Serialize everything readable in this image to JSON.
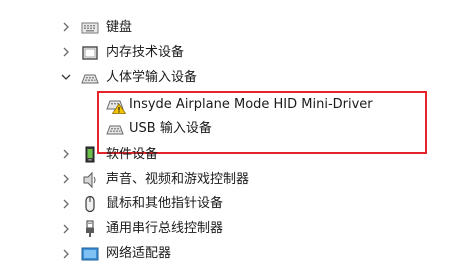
{
  "tree": {
    "items": [
      {
        "label": "键盘",
        "expanded": false,
        "icon": "keyboard-icon"
      },
      {
        "label": "内存技术设备",
        "expanded": false,
        "icon": "memory-device-icon"
      },
      {
        "label": "人体学输入设备",
        "expanded": true,
        "icon": "hid-icon",
        "children": [
          {
            "label": "Insyde Airplane Mode HID Mini-Driver",
            "icon": "hid-warning-icon",
            "warning": true
          },
          {
            "label": "USB 输入设备",
            "icon": "hid-icon"
          }
        ]
      },
      {
        "label": "软件设备",
        "expanded": false,
        "icon": "software-device-icon"
      },
      {
        "label": "声音、视频和游戏控制器",
        "expanded": false,
        "icon": "speaker-icon"
      },
      {
        "label": "鼠标和其他指针设备",
        "expanded": false,
        "icon": "mouse-icon"
      },
      {
        "label": "通用串行总线控制器",
        "expanded": false,
        "icon": "usb-icon"
      },
      {
        "label": "网络适配器",
        "expanded": false,
        "icon": "network-adapter-icon"
      }
    ]
  },
  "colors": {
    "highlight_border": "#e3242b",
    "warning": "#f5c400",
    "chevron": "#6b6b6b"
  }
}
